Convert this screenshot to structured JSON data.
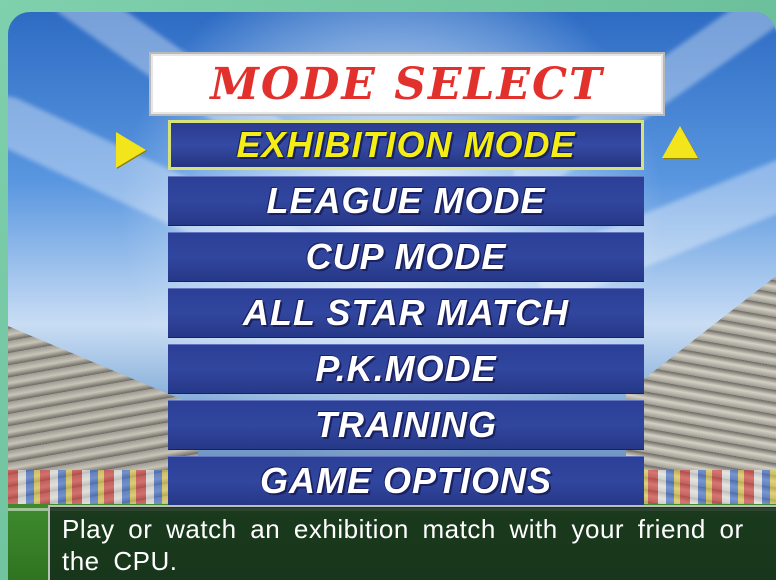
{
  "title": "MODE SELECT",
  "menu": {
    "items": [
      {
        "label": "EXHIBITION MODE"
      },
      {
        "label": "LEAGUE MODE"
      },
      {
        "label": "CUP MODE"
      },
      {
        "label": "ALL STAR MATCH"
      },
      {
        "label": "P.K.MODE"
      },
      {
        "label": "TRAINING"
      },
      {
        "label": "GAME OPTIONS"
      }
    ],
    "selected_index": 0
  },
  "description": "Play or watch an exhibition match with your friend or the CPU.",
  "icons": {
    "left_arrow": "arrow-right-icon",
    "up_arrow": "arrow-up-icon"
  },
  "colors": {
    "title_red": "#e2312c",
    "selected_yellow": "#f4ee14",
    "menu_blue": "#2e429b",
    "arrow_yellow": "#f2e51c"
  }
}
